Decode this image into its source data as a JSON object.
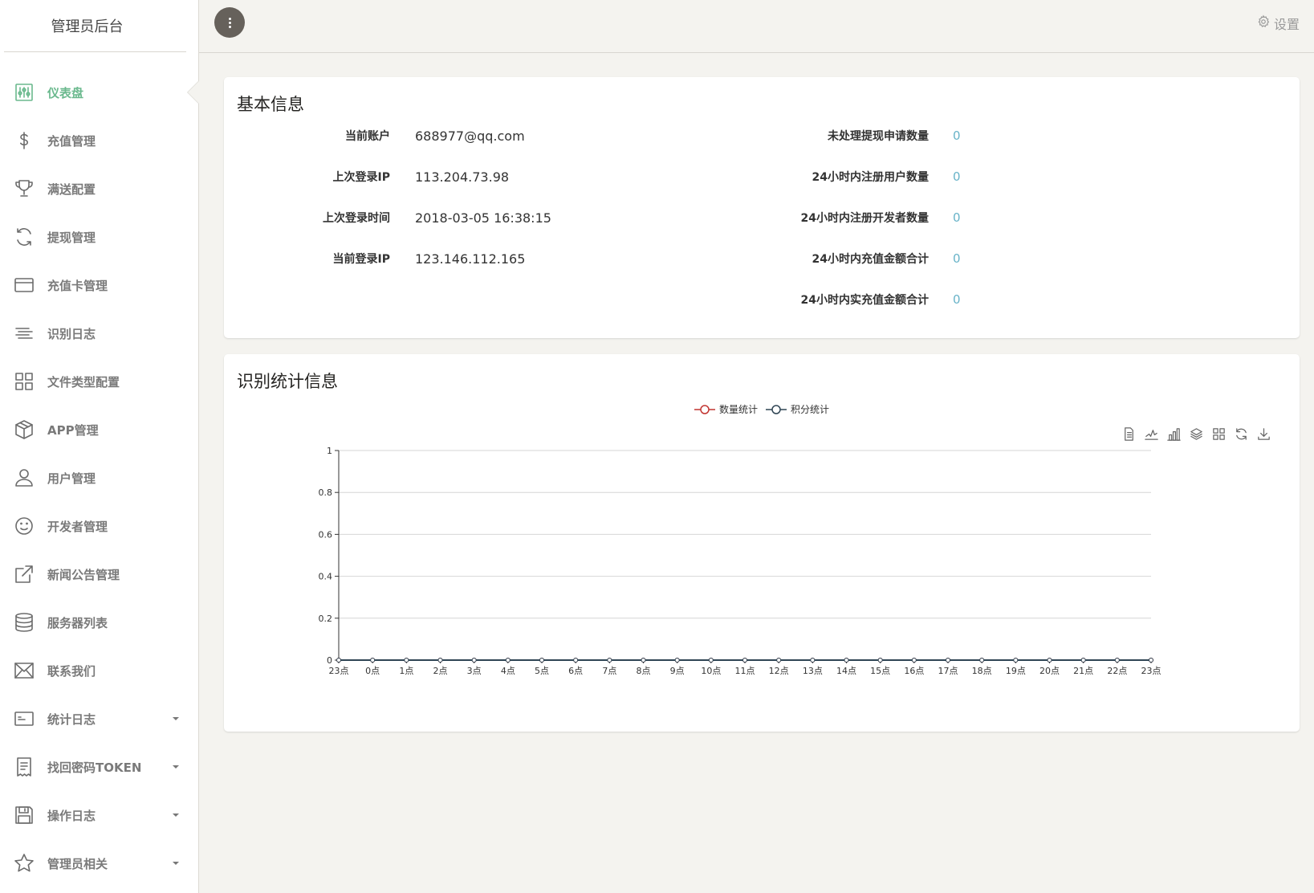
{
  "sidebar": {
    "brand": "管理员后台",
    "items": [
      {
        "label": "仪表盘",
        "icon": "dashboard-icon",
        "active": true
      },
      {
        "label": "充值管理",
        "icon": "dollar-icon"
      },
      {
        "label": "满送配置",
        "icon": "trophy-icon"
      },
      {
        "label": "提现管理",
        "icon": "refresh-icon"
      },
      {
        "label": "充值卡管理",
        "icon": "credit-card-icon"
      },
      {
        "label": "识别日志",
        "icon": "align-left-icon"
      },
      {
        "label": "文件类型配置",
        "icon": "grid-icon"
      },
      {
        "label": "APP管理",
        "icon": "box-icon"
      },
      {
        "label": "用户管理",
        "icon": "user-icon"
      },
      {
        "label": "开发者管理",
        "icon": "smiley-icon"
      },
      {
        "label": "新闻公告管理",
        "icon": "external-link-icon"
      },
      {
        "label": "服务器列表",
        "icon": "database-icon"
      },
      {
        "label": "联系我们",
        "icon": "envelope-icon"
      },
      {
        "label": "统计日志",
        "icon": "id-card-icon",
        "dropdown": true
      },
      {
        "label": "找回密码TOKEN",
        "icon": "receipt-icon",
        "dropdown": true
      },
      {
        "label": "操作日志",
        "icon": "floppy-icon",
        "dropdown": true
      },
      {
        "label": "管理员相关",
        "icon": "star-icon",
        "dropdown": true
      }
    ]
  },
  "topbar": {
    "settings_label": "设置",
    "menu_icon": "more-vertical-icon",
    "settings_icon": "gear-icon"
  },
  "basic_info": {
    "title": "基本信息",
    "left": [
      {
        "label": "当前账户",
        "value": "688977@qq.com"
      },
      {
        "label": "上次登录IP",
        "value": "113.204.73.98"
      },
      {
        "label": "上次登录时间",
        "value": "2018-03-05 16:38:15"
      },
      {
        "label": "当前登录IP",
        "value": "123.146.112.165"
      }
    ],
    "right": [
      {
        "label": "未处理提现申请数量",
        "value": "0"
      },
      {
        "label": "24小时内注册用户数量",
        "value": "0"
      },
      {
        "label": "24小时内注册开发者数量",
        "value": "0"
      },
      {
        "label": "24小时内充值金额合计",
        "value": "0"
      },
      {
        "label": "24小时内实充值金额合计",
        "value": "0"
      }
    ]
  },
  "stats": {
    "title": "识别统计信息",
    "toolbox": [
      "data-view-icon",
      "line-chart-icon",
      "bar-chart-icon",
      "stack-icon",
      "tiled-icon",
      "restore-icon",
      "download-icon"
    ]
  },
  "colors": {
    "accent_green": "#6bb98e",
    "value_blue": "#68b3c8",
    "series_count": "#c23531",
    "series_points": "#2f4554"
  },
  "chart_data": {
    "type": "line",
    "title": "",
    "xlabel": "",
    "ylabel": "",
    "categories": [
      "23点",
      "0点",
      "1点",
      "2点",
      "3点",
      "4点",
      "5点",
      "6点",
      "7点",
      "8点",
      "9点",
      "10点",
      "11点",
      "12点",
      "13点",
      "14点",
      "15点",
      "16点",
      "17点",
      "18点",
      "19点",
      "20点",
      "21点",
      "22点",
      "23点"
    ],
    "ylim": [
      0,
      1
    ],
    "yticks": [
      "0",
      "0.2",
      "0.4",
      "0.6",
      "0.8",
      "1"
    ],
    "grid": true,
    "legend_position": "top-center",
    "series": [
      {
        "name": "数量统计",
        "color": "#c23531",
        "values": [
          0,
          0,
          0,
          0,
          0,
          0,
          0,
          0,
          0,
          0,
          0,
          0,
          0,
          0,
          0,
          0,
          0,
          0,
          0,
          0,
          0,
          0,
          0,
          0,
          0
        ]
      },
      {
        "name": "积分统计",
        "color": "#2f4554",
        "values": [
          0,
          0,
          0,
          0,
          0,
          0,
          0,
          0,
          0,
          0,
          0,
          0,
          0,
          0,
          0,
          0,
          0,
          0,
          0,
          0,
          0,
          0,
          0,
          0,
          0
        ]
      }
    ]
  }
}
